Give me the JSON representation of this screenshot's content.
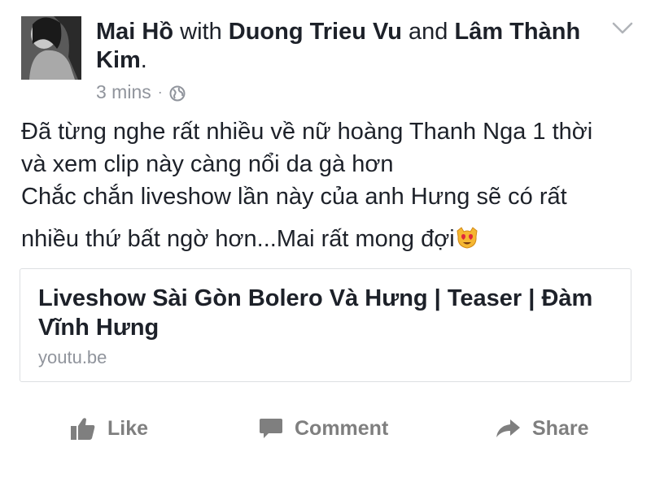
{
  "post": {
    "author": "Mai Hồ",
    "with_word": "with",
    "tagged_1": "Duong Trieu Vu",
    "and_word": "and",
    "tagged_2": "Lâm Thành Kim",
    "period": ".",
    "time": "3 mins",
    "separator": "·",
    "privacy_icon": "globe-icon",
    "menu_icon": "chevron-down-icon",
    "body_lines": [
      "Đã từng nghe rất nhiều về nữ hoàng Thanh Nga 1 thời",
      "và xem clip này càng nổi da gà hơn",
      "Chắc chắn liveshow lần này của anh Hưng sẽ có rất",
      "nhiều thứ bất ngờ hơn...Mai rất mong đợi"
    ],
    "emoji_icon": "heart-eyes-cat-emoji"
  },
  "link_preview": {
    "title": "Liveshow Sài Gòn Bolero Và Hưng | Teaser | Đàm Vĩnh Hưng",
    "domain": "youtu.be"
  },
  "actions": {
    "like_label": "Like",
    "comment_label": "Comment",
    "share_label": "Share"
  },
  "colors": {
    "text": "#1d2129",
    "meta": "#90949c",
    "action": "#7f7f7f",
    "card_border": "#dddfe2"
  }
}
